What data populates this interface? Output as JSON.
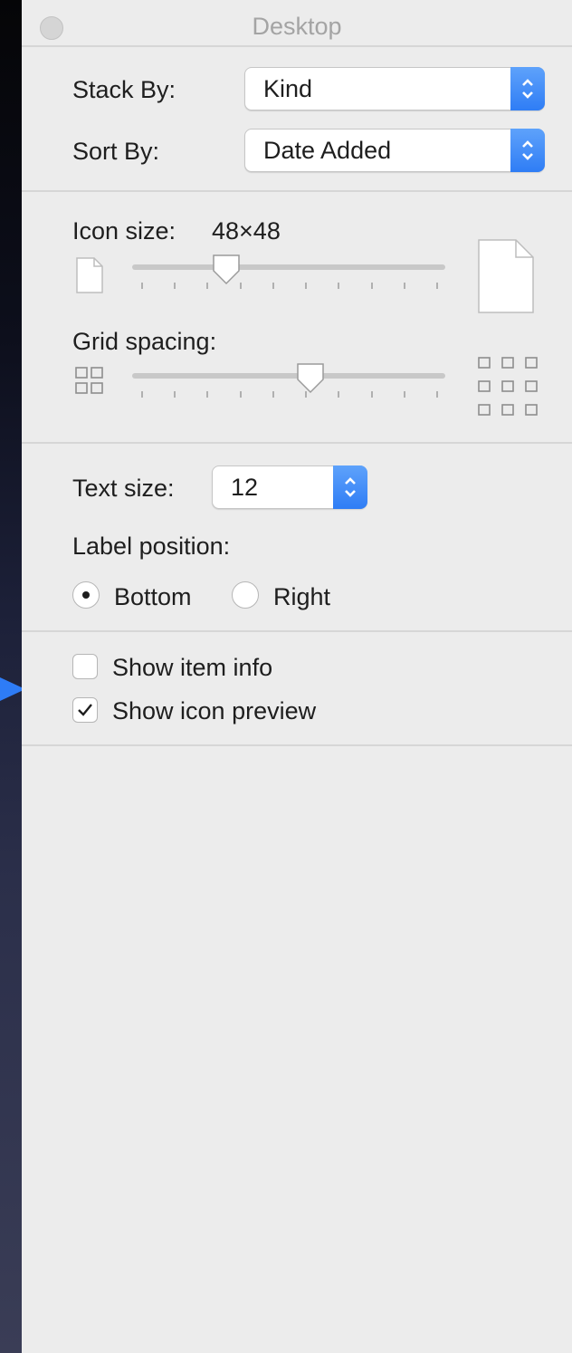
{
  "window": {
    "title": "Desktop"
  },
  "arrange": {
    "stack_by": {
      "label": "Stack By:",
      "value": "Kind"
    },
    "sort_by": {
      "label": "Sort By:",
      "value": "Date Added"
    }
  },
  "icon_size": {
    "label": "Icon size:",
    "value_text": "48×48",
    "slider_fraction": 0.3
  },
  "grid_spacing": {
    "label": "Grid spacing:",
    "slider_fraction": 0.57
  },
  "text": {
    "size_label": "Text size:",
    "size_value": "12",
    "label_position_title": "Label position:",
    "options": [
      {
        "label": "Bottom",
        "selected": true
      },
      {
        "label": "Right",
        "selected": false
      }
    ]
  },
  "checkboxes": [
    {
      "label": "Show item info",
      "checked": false
    },
    {
      "label": "Show icon preview",
      "checked": true
    }
  ],
  "colors": {
    "accent": "#3b86f7",
    "panel": "#ececec",
    "pointer": "#2e7cf6"
  }
}
